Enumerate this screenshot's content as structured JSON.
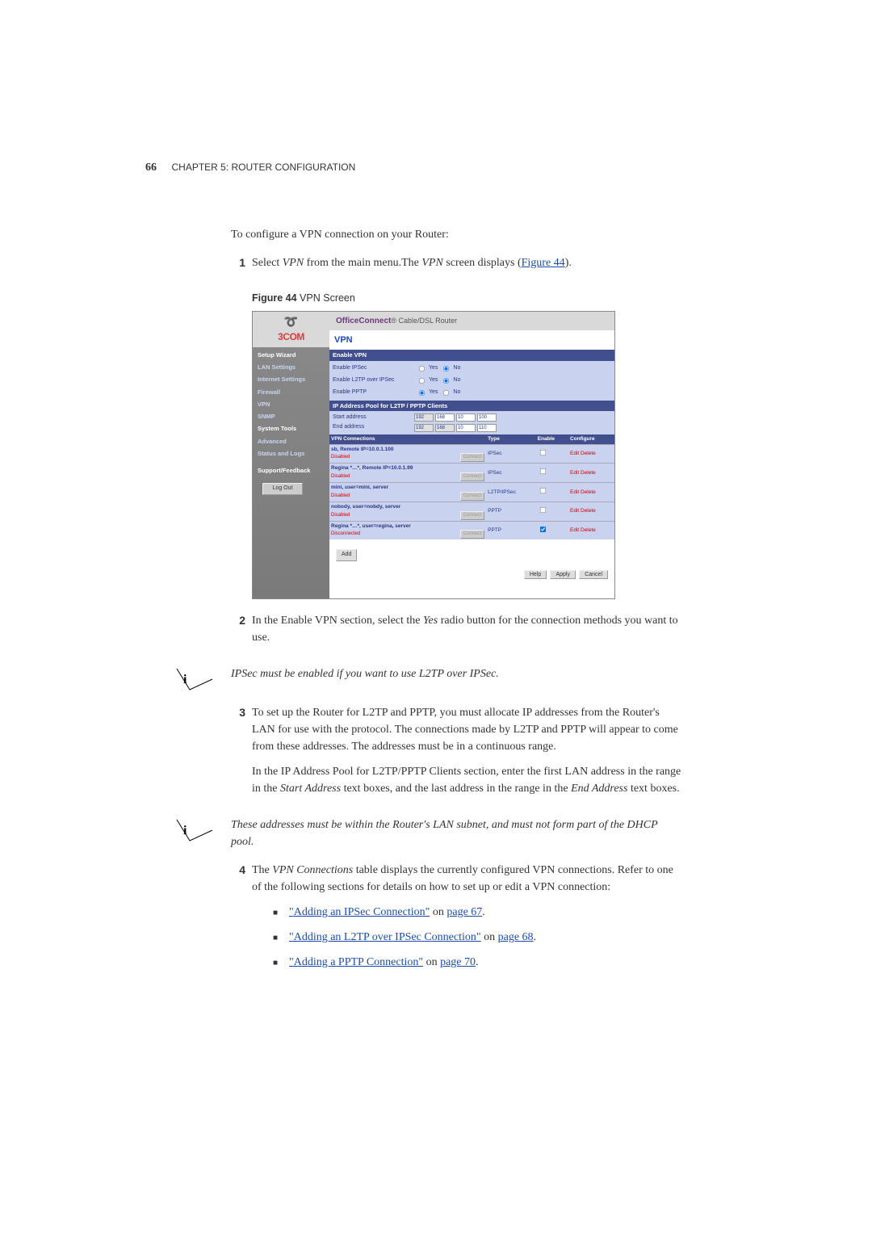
{
  "header": {
    "page_num": "66",
    "chapter": "CHAPTER 5: ROUTER CONFIGURATION"
  },
  "intro": "To configure a VPN connection on your Router:",
  "step1": {
    "num": "1",
    "pre": "Select ",
    "ital1": "VPN",
    "mid": " from the main menu.The ",
    "ital2": "VPN",
    "post": " screen displays (",
    "linktext": "Figure 44",
    "end": ")."
  },
  "figcap": {
    "label": "Figure 44",
    "text": "   VPN Screen"
  },
  "screenshot": {
    "logo": "3COM",
    "title_bold": "OfficeConnect",
    "title_rest": "® Cable/DSL Router",
    "vpn_heading": "VPN",
    "nav": {
      "setup": "Setup Wizard",
      "lan": "LAN Settings",
      "internet": "Internet Settings",
      "firewall": "Firewall",
      "vpn": "VPN",
      "snmp": "SNMP",
      "tools": "System Tools",
      "advanced": "Advanced",
      "status": "Status and Logs",
      "support": "Support/Feedback",
      "logout": "Log Out"
    },
    "enable_section": {
      "header": "Enable VPN",
      "ipsec": "Enable IPSec",
      "l2tp": "Enable L2TP over IPSec",
      "pptp": "Enable PPTP",
      "yes": "Yes",
      "no": "No"
    },
    "pool_section": {
      "header": "IP Address Pool for L2TP / PPTP Clients",
      "start": "Start address",
      "end": "End address",
      "v1": "192",
      "v2": "168",
      "v3": "10",
      "v4a": "100",
      "v4b": "110"
    },
    "conns": {
      "header": "VPN Connections",
      "th_type": "Type",
      "th_enable": "Enable",
      "th_conf": "Configure",
      "connect": "Connect",
      "edit": "Edit",
      "delete": "Delete",
      "rows": [
        {
          "name": "sb, Remote IP=10.0.1.100",
          "status": "Disabled",
          "type": "IPSec"
        },
        {
          "name": "Regina *…*, Remote IP=10.0.1.99",
          "status": "Disabled",
          "type": "IPSec"
        },
        {
          "name": "mini, user=mini, server",
          "status": "Disabled",
          "type": "L2TP/IPSec"
        },
        {
          "name": "nobody, user=nobdy, server",
          "status": "Disabled",
          "type": "PPTP"
        },
        {
          "name": "Regina *…*, user=regina, server",
          "status": "Disconnected",
          "type": "PPTP"
        }
      ],
      "add": "Add"
    },
    "buttons": {
      "help": "Help",
      "apply": "Apply",
      "cancel": "Cancel"
    }
  },
  "step2": {
    "num": "2",
    "pre": "In the Enable VPN section, select the ",
    "ital": "Yes",
    "post": " radio button for the connection methods you want to use."
  },
  "note1": "IPSec must be enabled if you want to use L2TP over IPSec.",
  "step3": {
    "num": "3",
    "p1": "To set up the Router for L2TP and PPTP, you must allocate IP addresses from the Router's LAN for use with the protocol. The connections made by L2TP and PPTP will appear to come from these addresses. The addresses must be in a continuous range.",
    "p2a": "In the IP Address Pool for L2TP/PPTP Clients section, enter the first LAN address in the range in the ",
    "p2it1": "Start Address",
    "p2b": " text boxes, and the last address in the range in the ",
    "p2it2": "End Address",
    "p2c": " text boxes."
  },
  "note2": "These addresses must be within the Router's LAN subnet, and must not form part of the DHCP pool.",
  "step4": {
    "num": "4",
    "pre": "The ",
    "ital": "VPN Connections",
    "post": " table displays the currently configured VPN connections. Refer to one of the following sections for details on how to set up or edit a VPN connection:"
  },
  "bullets": {
    "b1": {
      "link": "\"Adding an IPSec Connection\"",
      "on": " on ",
      "page": "page 67",
      "end": "."
    },
    "b2": {
      "link": "\"Adding an L2TP over IPSec Connection\"",
      "on": " on ",
      "page": "page 68",
      "end": "."
    },
    "b3": {
      "link": "\"Adding a PPTP Connection\"",
      "on": " on ",
      "page": "page 70",
      "end": "."
    }
  }
}
